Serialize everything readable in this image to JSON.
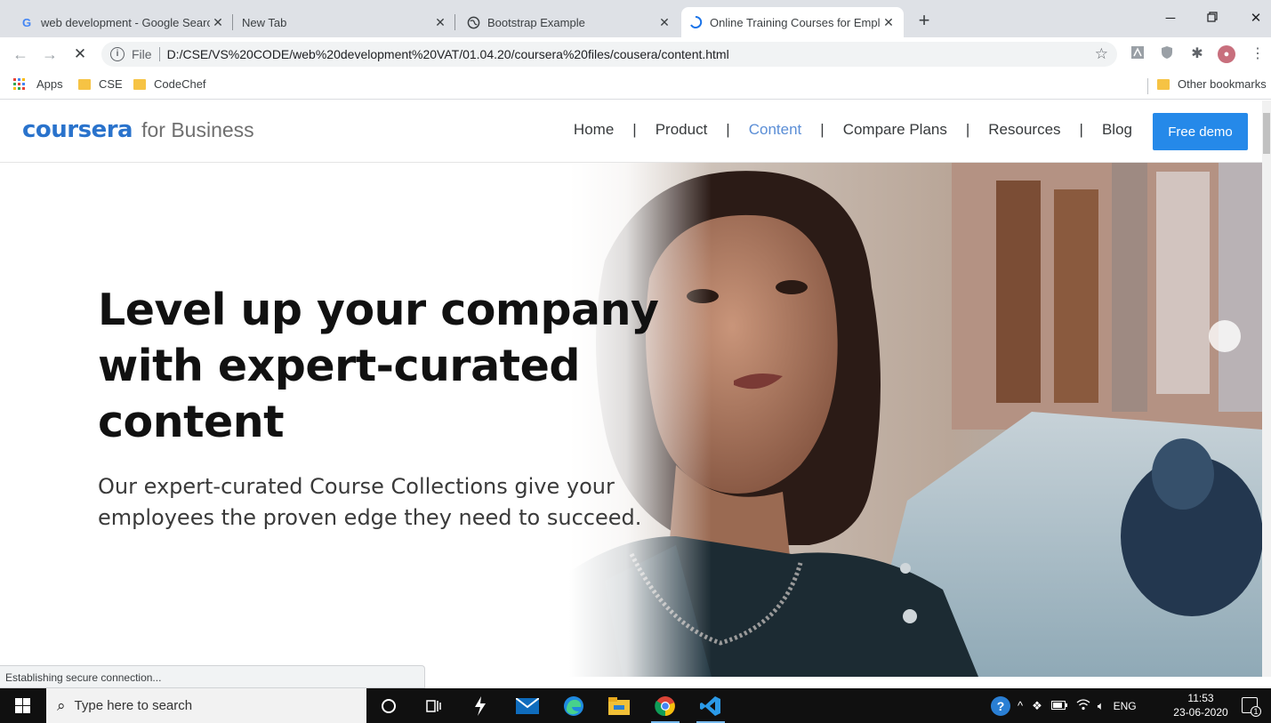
{
  "browser": {
    "tabs": [
      {
        "title": "web development - Google Searc",
        "favicon": "google-icon",
        "active": false
      },
      {
        "title": "New Tab",
        "favicon": "",
        "active": false
      },
      {
        "title": "Bootstrap Example",
        "favicon": "globe-icon",
        "active": false
      },
      {
        "title": "Online Training Courses for Empl",
        "favicon": "loading-spinner-icon",
        "active": true
      }
    ],
    "address": {
      "scheme_label": "File",
      "url": "D:/CSE/VS%20CODE/web%20development%20VAT/01.04.20/coursera%20files/cousera/content.html"
    },
    "bookmarks": {
      "apps_label": "Apps",
      "items": [
        "CSE",
        "CodeChef"
      ],
      "other_label": "Other bookmarks"
    },
    "status_text": "Establishing secure connection..."
  },
  "site": {
    "logo_main": "coursera",
    "logo_sub": "for Business",
    "nav": [
      {
        "label": "Home",
        "active": false
      },
      {
        "label": "Product",
        "active": false
      },
      {
        "label": "Content",
        "active": true
      },
      {
        "label": "Compare Plans",
        "active": false
      },
      {
        "label": "Resources",
        "active": false
      },
      {
        "label": "Blog",
        "active": false
      }
    ],
    "nav_separator": "|",
    "cta_label": "Free demo",
    "hero": {
      "title_lines": [
        "Level up your company",
        "with expert-curated",
        "content"
      ],
      "subtitle_lines": [
        "Our expert-curated Course Collections give your",
        "employees the proven edge they need to succeed."
      ]
    },
    "colors": {
      "brand": "#2a73cc",
      "cta": "#2589e9",
      "nav_active": "#5b8ed6"
    }
  },
  "taskbar": {
    "search_placeholder": "Type here to search",
    "language": "ENG",
    "time": "11:53",
    "date": "23-06-2020",
    "notification_count": "1"
  }
}
